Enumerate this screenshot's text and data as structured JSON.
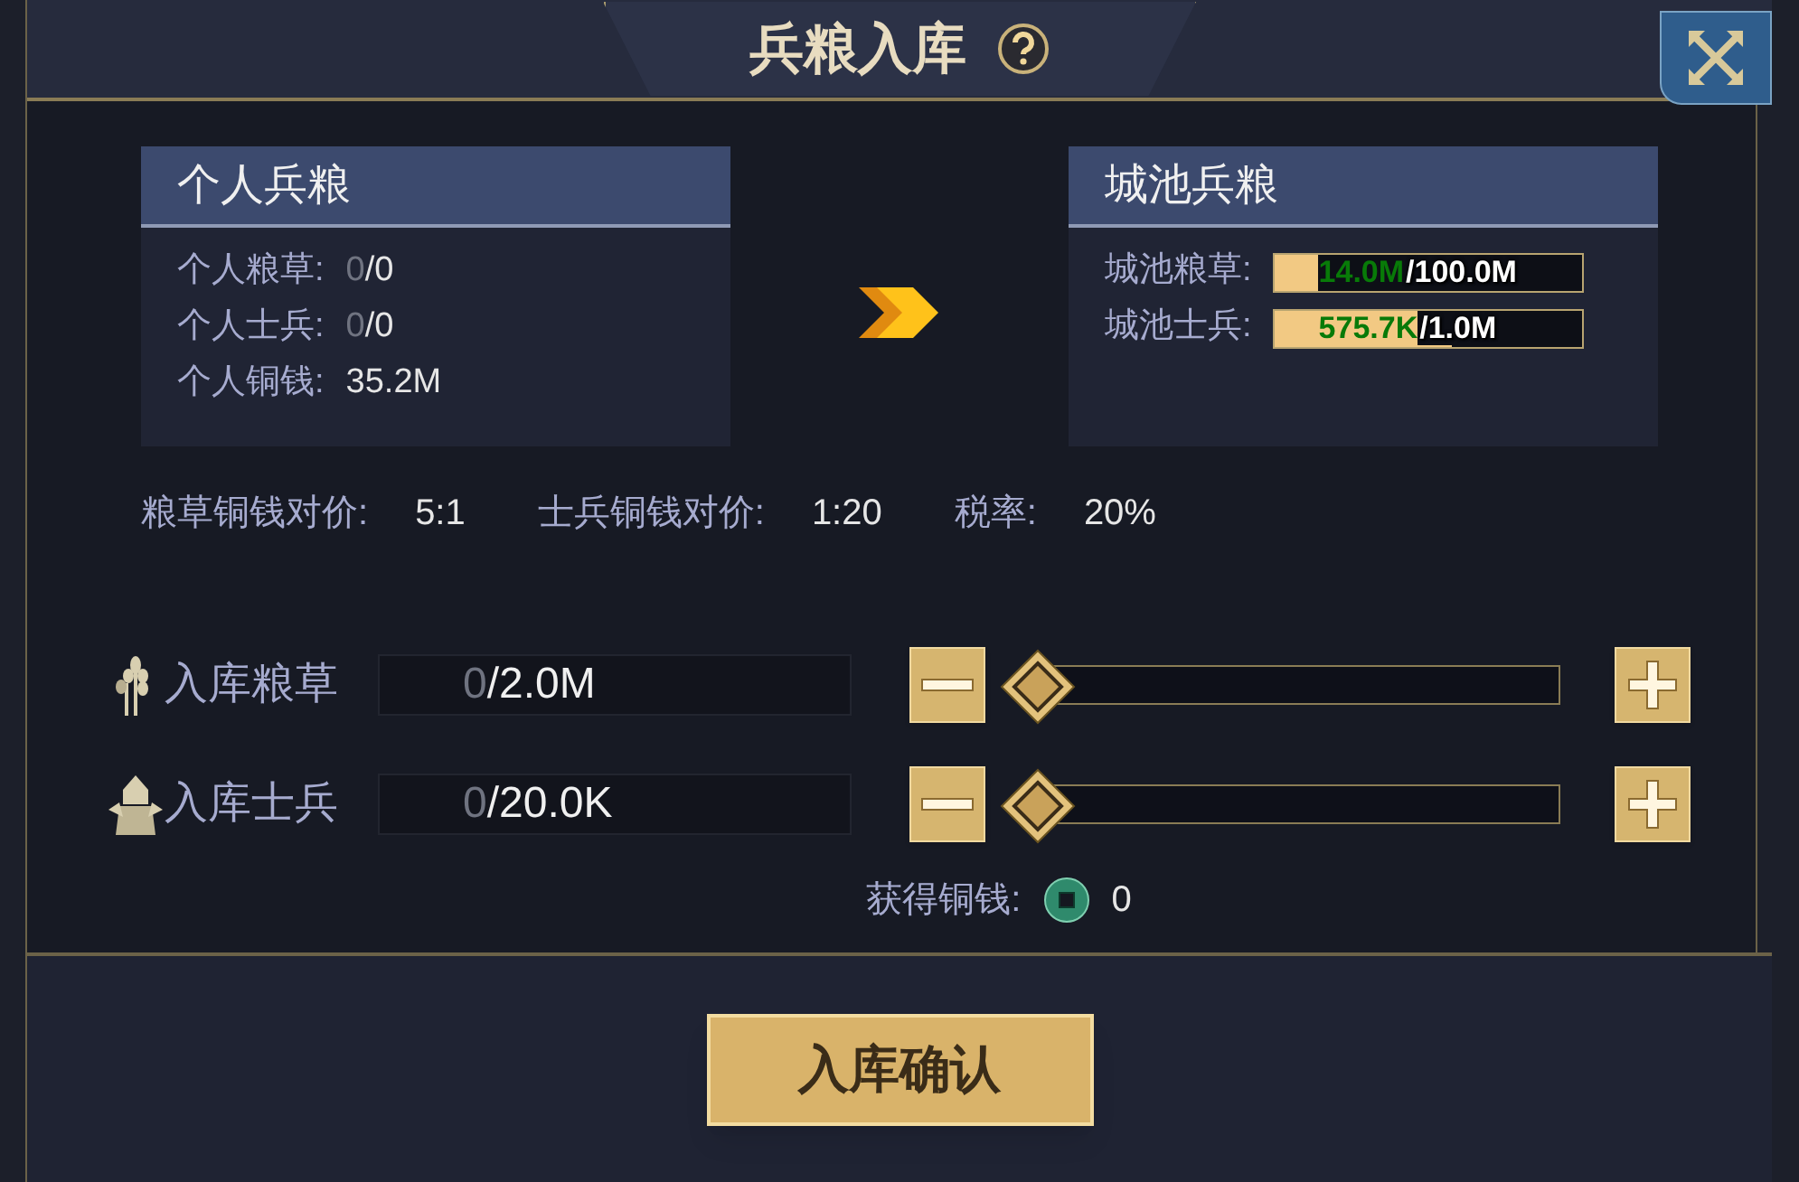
{
  "window": {
    "title": "兵粮入库"
  },
  "personal": {
    "title": "个人兵粮",
    "rows": [
      {
        "label": "个人粮草:",
        "current": "0",
        "max": "/0"
      },
      {
        "label": "个人士兵:",
        "current": "0",
        "max": "/0"
      },
      {
        "label": "个人铜钱:",
        "value": "35.2M"
      }
    ]
  },
  "city": {
    "title": "城池兵粮",
    "rows": [
      {
        "label": "城池粮草:",
        "current": "14.0M",
        "max": "/100.0M",
        "level": 0.14
      },
      {
        "label": "城池士兵:",
        "current": "575.7K",
        "max": "/1.0M",
        "level": 0.5757
      }
    ]
  },
  "rates": [
    {
      "label": "粮草铜钱对价:",
      "value": "5:1"
    },
    {
      "label": "士兵铜钱对价:",
      "value": "1:20"
    },
    {
      "label": "税率:",
      "value": "20%"
    }
  ],
  "inputs": [
    {
      "kind": "grain",
      "label": "入库粮草",
      "current": "0",
      "max": "/2.0M",
      "level": 0
    },
    {
      "kind": "soldier",
      "label": "入库士兵",
      "current": "0",
      "max": "/20.0K",
      "level": 0
    }
  ],
  "reward": {
    "label": "获得铜钱:",
    "value": "0"
  },
  "confirm_button": "入库确认"
}
